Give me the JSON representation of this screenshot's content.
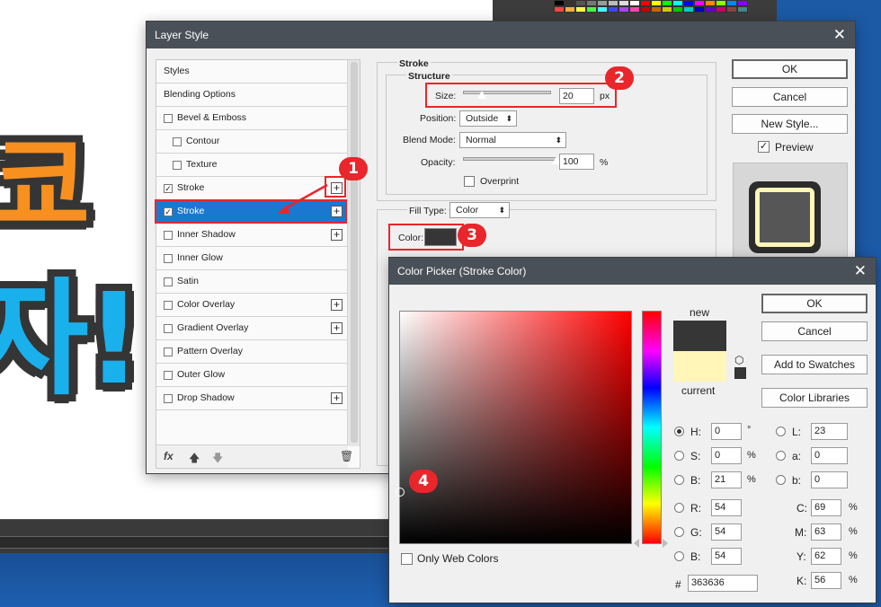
{
  "artwork": {
    "top_text": "쿄",
    "bottom_text": "자!"
  },
  "layer_style": {
    "title": "Layer Style",
    "styles": [
      {
        "label": "Styles",
        "checkbox": false,
        "plus": false,
        "checked": false
      },
      {
        "label": "Blending Options",
        "checkbox": false,
        "plus": false,
        "checked": false
      },
      {
        "label": "Bevel & Emboss",
        "checkbox": true,
        "plus": false,
        "checked": false
      },
      {
        "label": "Contour",
        "checkbox": true,
        "plus": false,
        "checked": false
      },
      {
        "label": "Texture",
        "checkbox": true,
        "plus": false,
        "checked": false
      },
      {
        "label": "Stroke",
        "checkbox": true,
        "plus": true,
        "checked": true
      },
      {
        "label": "Stroke",
        "checkbox": true,
        "plus": true,
        "checked": true
      },
      {
        "label": "Inner Shadow",
        "checkbox": true,
        "plus": true,
        "checked": false
      },
      {
        "label": "Inner Glow",
        "checkbox": true,
        "plus": false,
        "checked": false
      },
      {
        "label": "Satin",
        "checkbox": true,
        "plus": false,
        "checked": false
      },
      {
        "label": "Color Overlay",
        "checkbox": true,
        "plus": true,
        "checked": false
      },
      {
        "label": "Gradient Overlay",
        "checkbox": true,
        "plus": true,
        "checked": false
      },
      {
        "label": "Pattern Overlay",
        "checkbox": true,
        "plus": false,
        "checked": false
      },
      {
        "label": "Outer Glow",
        "checkbox": true,
        "plus": false,
        "checked": false
      },
      {
        "label": "Drop Shadow",
        "checkbox": true,
        "plus": true,
        "checked": false
      }
    ],
    "footer_fx": "fx",
    "section_title": "Stroke",
    "structure_title": "Structure",
    "size_label": "Size:",
    "size_value": "20",
    "size_unit": "px",
    "size_slider_fraction": 0.1,
    "position_label": "Position:",
    "position_value": "Outside",
    "blend_label": "Blend Mode:",
    "blend_value": "Normal",
    "opacity_label": "Opacity:",
    "opacity_value": "100",
    "opacity_unit": "%",
    "opacity_slider_fraction": 1.0,
    "overprint_label": "Overprint",
    "fill_type_label": "Fill Type:",
    "fill_type_value": "Color",
    "color_label": "Color:",
    "stroke_color": "#363636",
    "buttons": {
      "ok": "OK",
      "cancel": "Cancel",
      "new_style": "New Style..."
    },
    "preview_label": "Preview",
    "preview_checked": true
  },
  "annotations": [
    "1",
    "2",
    "3",
    "4"
  ],
  "color_picker": {
    "title": "Color Picker (Stroke Color)",
    "new_label": "new",
    "current_label": "current",
    "new_color": "#363636",
    "current_color": "#fff6b8",
    "buttons": {
      "ok": "OK",
      "cancel": "Cancel",
      "add_swatches": "Add to Swatches",
      "color_libraries": "Color Libraries"
    },
    "only_web_colors": "Only Web Colors",
    "hsb": [
      {
        "label": "H:",
        "value": "0",
        "unit": "°",
        "selected": true
      },
      {
        "label": "S:",
        "value": "0",
        "unit": "%",
        "selected": false
      },
      {
        "label": "B:",
        "value": "21",
        "unit": "%",
        "selected": false
      }
    ],
    "rgb": [
      {
        "label": "R:",
        "value": "54"
      },
      {
        "label": "G:",
        "value": "54"
      },
      {
        "label": "B:",
        "value": "54"
      }
    ],
    "lab": [
      {
        "label": "L:",
        "value": "23"
      },
      {
        "label": "a:",
        "value": "0"
      },
      {
        "label": "b:",
        "value": "0"
      }
    ],
    "cmyk": [
      {
        "label": "C:",
        "value": "69",
        "unit": "%"
      },
      {
        "label": "M:",
        "value": "63",
        "unit": "%"
      },
      {
        "label": "Y:",
        "value": "62",
        "unit": "%"
      },
      {
        "label": "K:",
        "value": "56",
        "unit": "%"
      }
    ],
    "hex_label": "#",
    "hex_value": "363636"
  },
  "colors": {
    "accent": "#1a78d0",
    "annotation_red": "#e8262b",
    "titlebar": "#4a5057"
  }
}
